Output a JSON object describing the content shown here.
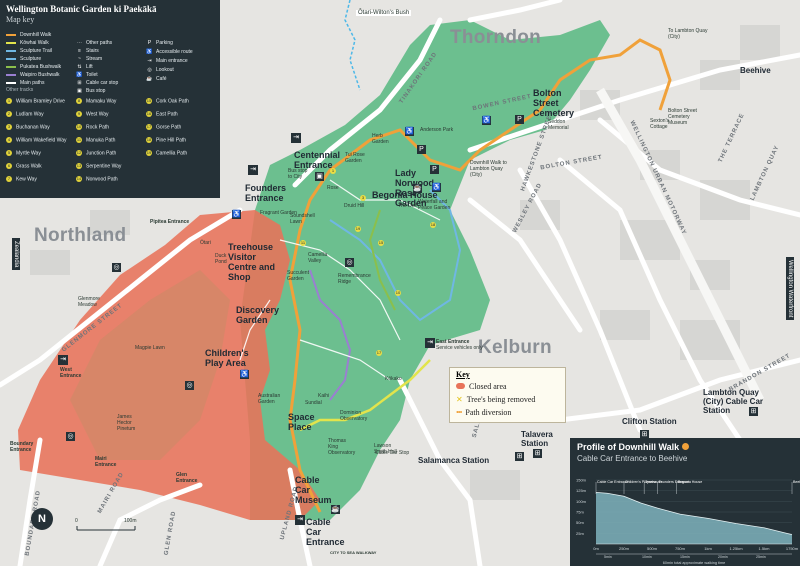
{
  "colors": {
    "garden": "#6cbf8f",
    "closed": "#e8735a",
    "downhill": "#f0a13a",
    "kowhai": "#e2e44c",
    "sculpture": "#6fb7e3",
    "roads": "#ffffff",
    "panel": "#253137"
  },
  "legend": {
    "title": "Wellington Botanic Garden ki Paekākā",
    "subtitle": "Map key",
    "lines": [
      {
        "label": "Downhill Walk",
        "color": "#f0a13a"
      },
      {
        "label": "Kōwhai Walk",
        "color": "#e2e44c"
      },
      {
        "label": "Sculpture Trail",
        "color": "#6fb7e3"
      },
      {
        "label": "Sculpture",
        "color": "#6fb7e3"
      },
      {
        "label": "Pukatea Bushwalk",
        "color": "#8bbf4c"
      },
      {
        "label": "Waipiro Bushwalk",
        "color": "#9a7fd1"
      },
      {
        "label": "Main paths",
        "color": "#ffffff"
      }
    ],
    "other_tracks_label": "Other tracks",
    "mid": [
      {
        "icon": "dots",
        "label": "Other paths"
      },
      {
        "icon": "stairs",
        "label": "Stairs"
      },
      {
        "icon": "stream",
        "label": "Stream"
      },
      {
        "icon": "lift",
        "label": "Lift"
      },
      {
        "icon": "toilet",
        "label": "Toilet"
      },
      {
        "icon": "cable",
        "label": "Cable car stop"
      },
      {
        "icon": "bus",
        "label": "Bus stop"
      }
    ],
    "right": [
      {
        "icon": "P",
        "label": "Parking"
      },
      {
        "icon": "access",
        "label": "Accessible route"
      },
      {
        "icon": "entry",
        "label": "Main entrance"
      },
      {
        "icon": "look",
        "label": "Lookout"
      },
      {
        "icon": "cafe",
        "label": "Café"
      }
    ],
    "tracks_col1": [
      "William Bramley Drive",
      "Ludlam Way",
      "Buchanan Way",
      "William Wakefield Way",
      "Myrtle Way",
      "Grass Walk",
      "Kew Way"
    ],
    "tracks_col2": [
      "Mamaku Way",
      "West Way",
      "Rock Path",
      "Manuka Path",
      "Junction Path",
      "Serpentine Way",
      "Norwood Path"
    ],
    "tracks_col3": [
      "Cork Oak Path",
      "East Path",
      "Gorse Path",
      "Pine Hill Path",
      "Camellia Path"
    ],
    "track_numbers_col1": [
      "1",
      "2",
      "3",
      "4",
      "5",
      "6",
      "7"
    ],
    "track_numbers_col2": [
      "8",
      "9",
      "10",
      "11",
      "12",
      "13",
      "14"
    ],
    "track_numbers_col3": [
      "15",
      "16",
      "17",
      "18",
      "19"
    ]
  },
  "key": {
    "title": "Key",
    "closed": "Closed area",
    "trees": "Tree's being removed",
    "diversion": "Path diversion"
  },
  "suburbs": {
    "thorndon": "Thorndon",
    "northland": "Northland",
    "kelburn": "Kelburn"
  },
  "streets": {
    "tinakori": "TINAKORI ROAD",
    "bowen": "BOWEN STREET",
    "motorway": "WELLINGTON URBAN MOTORWAY",
    "terrace": "THE TERRACE",
    "bolton": "BOLTON STREET",
    "lambton": "LAMBTON QUAY",
    "hawkestone": "HAWKESTONE STREET",
    "wesley": "WESLEY ROAD",
    "salamanca": "SALAMANCA ROAD",
    "glenmore": "GLENMORE STREET",
    "upland": "UPLAND ROAD",
    "boundary": "BOUNDARY ROAD",
    "mairi": "MAIRI ROAD",
    "glen": "GLEN ROAD",
    "brandon": "BRANDON STREET"
  },
  "places": {
    "centennial": "Centennial Entrance",
    "founders": "Founders Entrance",
    "bolton_cem": "Bolton Street Cemetery",
    "norwood": "Lady Norwood Rose Garden",
    "begonia": "Begonia House",
    "treehouse": "Treehouse Visitor Centre and Shop",
    "discovery": "Discovery Garden",
    "childrens": "Children's Play Area",
    "space_place": "Space Place",
    "cable_museum": "Cable Car Museum",
    "cable_entrance": "Cable Car Entrance",
    "otari": "Ōtari-Wilton's Bush",
    "to_lambton": "To Lambton Quay (City)",
    "beehive": "Beehive",
    "lambton_station": "Lambton Quay (City) Cable Car Station",
    "clifton": "Clifton Station",
    "talavera": "Talavera Station",
    "salamanca_st": "Salamanca Station",
    "east_entrance": "East Entrance",
    "east_note": "Service vehicles only",
    "pipitea": "Pipitea Entrance",
    "west_entrance": "West Entrance",
    "boundary_entrance": "Boundary Entrance",
    "mairi_entrance": "Mairi Entrance",
    "glen_entrance": "Glen Entrance",
    "cable_stop": "Cable Car Stop",
    "seddon": "Seddon Memorial",
    "sextons": "Sexton's Cottage",
    "cem_museum": "Bolton Street Cemetery Museum",
    "anderson": "Anderson Park",
    "herb": "Herb Garden",
    "tui": "Tui Rose Garden",
    "bus_city": "Bus stop to City",
    "downhill_note": "Downhill Walk to Lambton Quay (City)",
    "waterfall": "Waterfall and Peace Garden",
    "dell": "The Dell",
    "druid": "Druid Hill",
    "remembrance": "Remembrance Ridge",
    "camellia": "Camellia Valley",
    "succulent": "Succulent Garden",
    "australian": "Australian Garden",
    "dominion": "Dominion Observatory",
    "thomas_king": "Thomas King Observatory",
    "lawson": "Lawson Smith Hall",
    "sundial": "Sundial",
    "magpie": "Magpie Lawn",
    "james_hector": "James Hector Pinetum",
    "glenmore_meadow": "Glenmore Meadow",
    "soundshell": "Soundshell Lawn",
    "duck_pond": "Duck Pond",
    "otari_short": "Ōtari",
    "zealandia": "Zealandia",
    "waterfront": "Wellington Waterfront",
    "rose": "Rose",
    "kokako": "Kōkako",
    "kaihi": "Kaihi",
    "fragrant": "Fragrant Garden",
    "to_sea": "CITY TO SEA WALKWAY"
  },
  "scale": {
    "zero": "0",
    "hundred": "100m"
  },
  "compass": "N",
  "profile": {
    "title": "Profile of Downhill Walk",
    "subtitle": "Cable Car Entrance to Beehive",
    "yticks": [
      "150m",
      "125m",
      "100m",
      "75m",
      "50m",
      "25m"
    ],
    "xticks": [
      "0m",
      "250m",
      "500m",
      "750m",
      "1km",
      "1.25km",
      "1.5km",
      "1750m"
    ],
    "times": [
      "5min",
      "10min",
      "15min",
      "20min",
      "25min"
    ],
    "footer": "60min total approximate walking time",
    "points": [
      {
        "label": "Cable Car Entrance",
        "distance_km": 0.0
      },
      {
        "label": "Children's Playarea",
        "distance_km": 0.25
      },
      {
        "label": "Treehouse",
        "distance_km": 0.43
      },
      {
        "label": "Founders Entrance",
        "distance_km": 0.55
      },
      {
        "label": "Begonia House",
        "distance_km": 0.72
      },
      {
        "label": "Beehive",
        "distance_km": 1.75
      }
    ],
    "elevation": [
      {
        "d": 0,
        "h": 121
      },
      {
        "d": 0.1,
        "h": 119
      },
      {
        "d": 0.25,
        "h": 112
      },
      {
        "d": 0.4,
        "h": 96
      },
      {
        "d": 0.55,
        "h": 84
      },
      {
        "d": 0.75,
        "h": 70
      },
      {
        "d": 1.0,
        "h": 60
      },
      {
        "d": 1.25,
        "h": 48
      },
      {
        "d": 1.5,
        "h": 38
      },
      {
        "d": 1.75,
        "h": 22
      }
    ]
  }
}
